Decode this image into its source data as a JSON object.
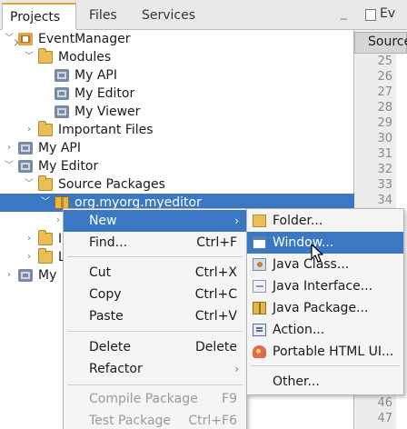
{
  "projects_panel": {
    "tabs": [
      {
        "label": "Projects",
        "close": "×"
      },
      {
        "label": "Files"
      },
      {
        "label": "Services"
      }
    ],
    "minimize": "_"
  },
  "tree": {
    "event_manager": "EventManager",
    "modules": "Modules",
    "my_api_module": "My API",
    "my_editor_module": "My Editor",
    "my_viewer_module": "My Viewer",
    "important_files": "Important Files",
    "my_api": "My API",
    "my_editor": "My Editor",
    "source_packages": "Source Packages",
    "package": "org.myorg.myeditor",
    "partial_row_1": "I",
    "partial_row_2": "L",
    "partial_row_3": "My"
  },
  "editor": {
    "tab_label": "Ev",
    "source_label": "Source",
    "line_numbers": [
      "25",
      "26",
      "27",
      "28",
      "29",
      "30",
      "31",
      "32",
      "33",
      "34",
      "",
      "",
      "",
      "",
      "",
      "",
      "",
      "",
      "",
      "",
      "",
      "46",
      "47"
    ]
  },
  "context_menu": {
    "items": [
      {
        "label": "New",
        "shortcut": "",
        "submenu": true
      },
      {
        "label": "Find...",
        "shortcut": "Ctrl+F"
      },
      {
        "label": "Cut",
        "shortcut": "Ctrl+X"
      },
      {
        "label": "Copy",
        "shortcut": "Ctrl+C"
      },
      {
        "label": "Paste",
        "shortcut": "Ctrl+V"
      },
      {
        "label": "Delete",
        "shortcut": "Delete"
      },
      {
        "label": "Refactor",
        "shortcut": "",
        "submenu": true
      },
      {
        "label": "Compile Package",
        "shortcut": "F9"
      },
      {
        "label": "Test Package",
        "shortcut": "Ctrl+F6"
      }
    ],
    "submenu_arrow": "›"
  },
  "submenu": {
    "items": [
      {
        "label": "Folder..."
      },
      {
        "label": "Window..."
      },
      {
        "label": "Java Class..."
      },
      {
        "label": "Java Interface..."
      },
      {
        "label": "Java Package..."
      },
      {
        "label": "Action..."
      },
      {
        "label": "Portable HTML UI..."
      },
      {
        "label": "Other..."
      }
    ]
  },
  "colors": {
    "selection": "#3b78c4",
    "tab_accent": "#f0a030",
    "menu_bg": "#f5f5f5"
  }
}
